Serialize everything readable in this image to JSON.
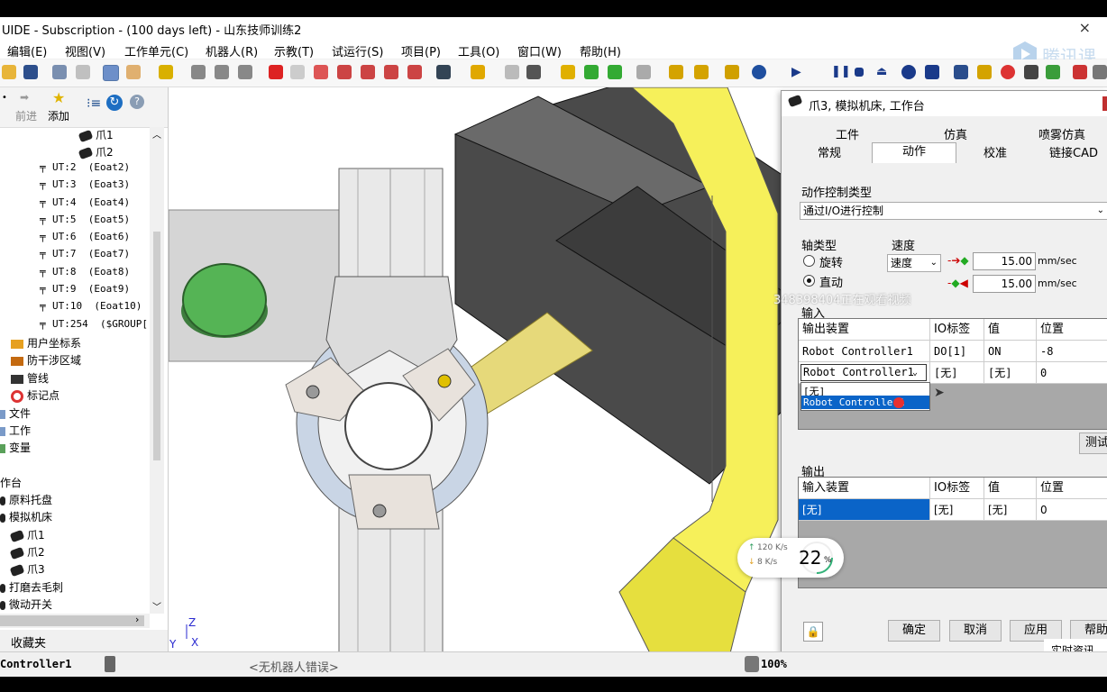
{
  "app": {
    "title": "UIDE - Subscription - (100 days left) - 山东技师训练2",
    "close": "×"
  },
  "menu": [
    "编辑(E)",
    "视图(V)",
    "工作单元(C)",
    "机器人(R)",
    "示教(T)",
    "试运行(S)",
    "项目(P)",
    "工具(O)",
    "窗口(W)",
    "帮助(H)"
  ],
  "logo_text": "腾讯课",
  "nav": {
    "forward": "前进",
    "add": "添加"
  },
  "tree": {
    "claws_top": [
      "爪1",
      "爪2"
    ],
    "uts": [
      {
        "id": "UT:2",
        "name": "(Eoat2)"
      },
      {
        "id": "UT:3",
        "name": "(Eoat3)"
      },
      {
        "id": "UT:4",
        "name": "(Eoat4)"
      },
      {
        "id": "UT:5",
        "name": "(Eoat5)"
      },
      {
        "id": "UT:6",
        "name": "(Eoat6)"
      },
      {
        "id": "UT:7",
        "name": "(Eoat7)"
      },
      {
        "id": "UT:8",
        "name": "(Eoat8)"
      },
      {
        "id": "UT:9",
        "name": "(Eoat9)"
      },
      {
        "id": "UT:10",
        "name": "(Eoat10)"
      },
      {
        "id": "UT:254",
        "name": "($GROUP["
      }
    ],
    "frames": [
      "用户坐标系",
      "防干涉区域",
      "管线",
      "标记点"
    ],
    "root": [
      "文件",
      "工作",
      "变量"
    ],
    "worktable": "作台",
    "parts": [
      "原料托盘",
      "模拟机床"
    ],
    "claws_bottom": [
      "爪1",
      "爪2",
      "爪3"
    ],
    "more": [
      "打磨去毛刺",
      "微动开关"
    ]
  },
  "favorites": "收藏夹",
  "axis": {
    "z": "Z",
    "y": "Y",
    "x": "X"
  },
  "dialog": {
    "title": "爪3, 模拟机床, 工作台",
    "tabs_top": [
      "工件",
      "仿真",
      "喷雾仿真"
    ],
    "tabs_bottom": [
      "常规",
      "动作",
      "校准",
      "链接CAD"
    ],
    "active_tab": "动作",
    "action_type_label": "动作控制类型",
    "action_type_value": "通过I/O进行控制",
    "axis_type_label": "轴类型",
    "axis_options": [
      "旋转",
      "直动"
    ],
    "axis_selected": "直动",
    "speed_label": "速度",
    "speed_combo": "速度",
    "speed_values": [
      "15.00",
      "15.00"
    ],
    "speed_unit": "mm/sec",
    "input_label": "输入",
    "output_label": "输出",
    "columns": [
      "输出装置",
      "IO标签",
      "值",
      "位置"
    ],
    "output_columns": [
      "输入装置",
      "IO标签",
      "值",
      "位置"
    ],
    "input_rows": [
      [
        "Robot Controller1",
        "DO[1]",
        "ON",
        "-8"
      ],
      [
        "Robot Controller1",
        "[无]",
        "[无]",
        "0"
      ]
    ],
    "dropdown_items": [
      "[无]",
      "Robot Controller1"
    ],
    "output_rows": [
      [
        "[无]",
        "[无]",
        "[无]",
        "0"
      ]
    ],
    "test_button": "测试",
    "buttons": [
      "确定",
      "取消",
      "应用",
      "帮助"
    ]
  },
  "overlay": {
    "watermark": "348398404正在观看视频",
    "upload": "120 K/s",
    "download": "8 K/s",
    "percent": "22",
    "percent_unit": "%",
    "notice": "实时资讯"
  },
  "status": {
    "controller": "Controller1",
    "message": "<无机器人错误>",
    "zoom": "100%"
  }
}
